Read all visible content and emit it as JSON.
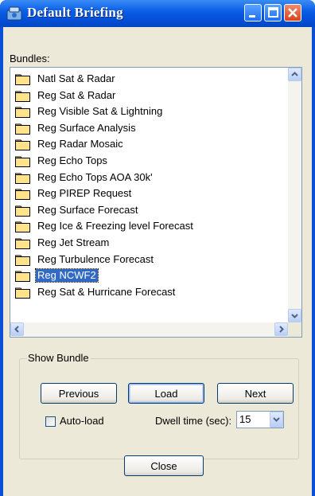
{
  "window": {
    "title": "Default Briefing",
    "controls": {
      "minimize": "minimize-icon",
      "maximize": "maximize-icon",
      "close": "close-icon"
    }
  },
  "bundles": {
    "label": "Bundles:",
    "items": [
      "Natl Sat & Radar",
      "Reg Sat & Radar",
      "Reg Visible Sat & Lightning",
      "Reg Surface Analysis",
      "Reg Radar Mosaic",
      "Reg Echo Tops",
      "Reg Echo Tops AOA 30k'",
      "Reg PIREP Request",
      "Reg Surface Forecast",
      "Reg Ice & Freezing  level Forecast",
      "Reg Jet Stream",
      "Reg Turbulence Forecast",
      "Reg NCWF2",
      "Reg Sat & Hurricane Forecast"
    ],
    "selected_index": 12
  },
  "show_bundle": {
    "label": "Show Bundle",
    "previous_label": "Previous",
    "load_label": "Load",
    "next_label": "Next",
    "autoload_label": "Auto-load",
    "autoload_checked": false,
    "dwell_label": "Dwell time (sec):",
    "dwell_value": "15"
  },
  "close_label": "Close",
  "colors": {
    "titlebar": "#0a5fe6",
    "selection": "#316ac5",
    "dialog_bg": "#ece9d8",
    "folder": "#ffe38a"
  }
}
